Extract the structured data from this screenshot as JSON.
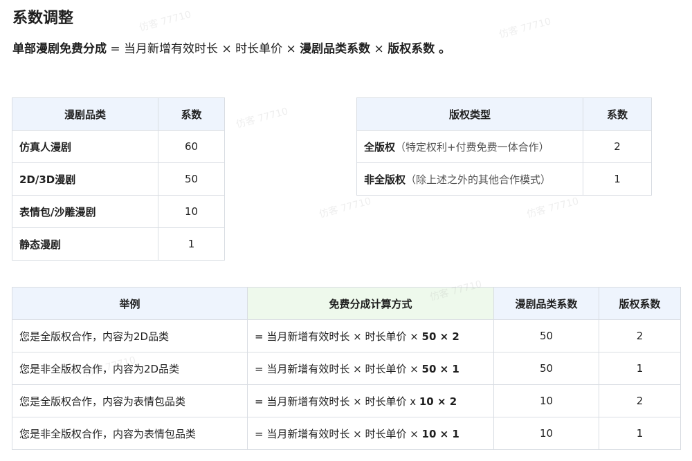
{
  "title": "系数调整",
  "formula": {
    "term1": "单部漫剧免费分成",
    "eq": " = 当月新增有效时长 × 时长单价 × ",
    "term2": "漫剧品类系数",
    "times": " × ",
    "term3": "版权系数",
    "end": " 。"
  },
  "category_table": {
    "headers": [
      "漫剧品类",
      "系数"
    ],
    "rows": [
      {
        "category": "仿真人漫剧",
        "coef": "60"
      },
      {
        "category": "2D/3D漫剧",
        "coef": "50"
      },
      {
        "category": "表情包/沙雕漫剧",
        "coef": "10"
      },
      {
        "category": "静态漫剧",
        "coef": "1"
      }
    ]
  },
  "copyright_table": {
    "headers": [
      "版权类型",
      "系数"
    ],
    "rows": [
      {
        "type": "全版权",
        "note": "（特定权利+付费免费一体合作）",
        "coef": "2"
      },
      {
        "type": "非全版权",
        "note": "（除上述之外的其他合作模式）",
        "coef": "1"
      }
    ]
  },
  "example_table": {
    "headers": [
      "举例",
      "免费分成计算方式",
      "漫剧品类系数",
      "版权系数"
    ],
    "rows": [
      {
        "example": "您是全版权合作，内容为2D品类",
        "calc_prefix": "= 当月新增有效时长 × 时长单价 × ",
        "calc_bold": "50 × 2",
        "cat": "50",
        "copy": "2"
      },
      {
        "example": "您是非全版权合作，内容为2D品类",
        "calc_prefix": "= 当月新增有效时长 × 时长单价 × ",
        "calc_bold": "50 × 1",
        "cat": "50",
        "copy": "1"
      },
      {
        "example": "您是全版权合作，内容为表情包品类",
        "calc_prefix": "= 当月新增有效时长 × 时长单价 x ",
        "calc_bold": "10 × 2",
        "cat": "10",
        "copy": "2"
      },
      {
        "example": "您是非全版权合作，内容为表情包品类",
        "calc_prefix": "= 当月新增有效时长 × 时长单价 × ",
        "calc_bold": "10 × 1",
        "cat": "10",
        "copy": "1"
      }
    ]
  },
  "watermark": "仿客 77710"
}
